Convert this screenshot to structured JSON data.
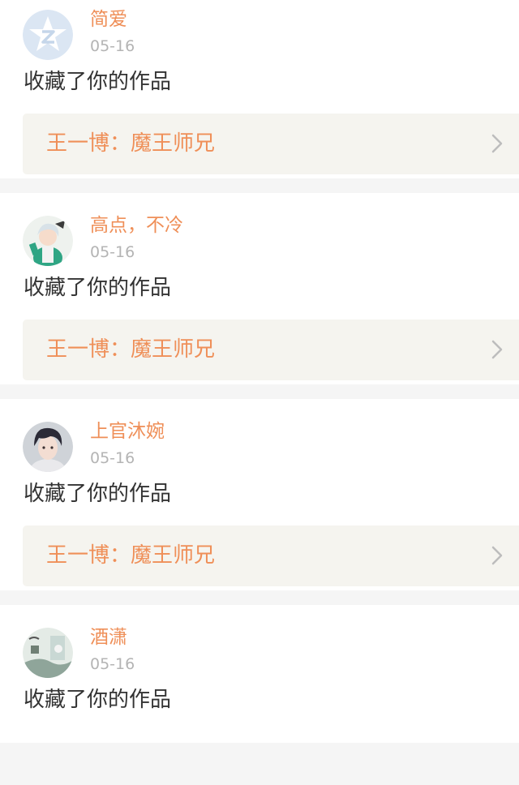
{
  "feed": {
    "items": [
      {
        "username": "简爱",
        "date": "05-16",
        "action": "收藏了你的作品",
        "work_title": "王一博：魔王师兄",
        "avatar_icon": "default-avatar-icon"
      },
      {
        "username": "高点，不冷",
        "date": "05-16",
        "action": "收藏了你的作品",
        "work_title": "王一博：魔王师兄",
        "avatar_icon": "anime-character-avatar"
      },
      {
        "username": "上官沐婉",
        "date": "05-16",
        "action": "收藏了你的作品",
        "work_title": "王一博：魔王师兄",
        "avatar_icon": "portrait-photo-avatar"
      },
      {
        "username": "酒潇",
        "date": "05-16",
        "action": "收藏了你的作品",
        "avatar_icon": "landscape-photo-avatar"
      }
    ]
  },
  "colors": {
    "accent": "#ef8f58",
    "date_text": "#b4b4b4",
    "body_text": "#333333",
    "link_background": "#f5f4ef",
    "divider_background": "#f5f5f5",
    "card_background": "#ffffff",
    "default_avatar": "#dbe6f3"
  }
}
